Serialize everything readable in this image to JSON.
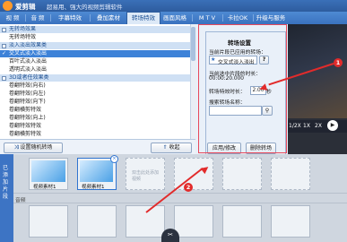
{
  "app": {
    "name": "爱剪辑",
    "slogan": "超易用、强大的视频剪辑软件"
  },
  "tabs": [
    "视 频",
    "音 频",
    "字幕特效",
    "叠加素材",
    "转场特效",
    "画面风格",
    "M T V",
    "卡拉OK",
    "升级与服务"
  ],
  "active_tab": "转场特效",
  "transition_list": [
    {
      "label": "无转场效果",
      "type": "category"
    },
    {
      "label": "无转场特效",
      "type": "item"
    },
    {
      "label": "淡入淡出效果类",
      "type": "category"
    },
    {
      "label": "交叉式淡入淡出",
      "type": "selected"
    },
    {
      "label": "百叶式淡入淡出",
      "type": "item"
    },
    {
      "label": "透明式淡入淡出",
      "type": "item"
    },
    {
      "label": "3D或者任效果类",
      "type": "category"
    },
    {
      "label": "卷翻特效(向右)",
      "type": "item"
    },
    {
      "label": "卷翻特效(向左)",
      "type": "item"
    },
    {
      "label": "卷翻特效(向下)",
      "type": "item"
    },
    {
      "label": "卷翻横剪特效",
      "type": "item"
    },
    {
      "label": "卷翻特效(向上)",
      "type": "item"
    },
    {
      "label": "卷翻特效特效",
      "type": "item"
    },
    {
      "label": "卷翻横剪特效",
      "type": "item"
    }
  ],
  "list_buttons": {
    "random": "设置随机转场",
    "collapse": "收起"
  },
  "settings": {
    "title": "转场设置",
    "current_label": "当前片段已应用的转场：",
    "current_value": "交叉式淡入淡出",
    "time_label": "当前选中片段的时长：",
    "time_value": "00:00:20.000",
    "duration_label": "转场特效时长：",
    "duration_value": "2.00",
    "duration_unit": "秒",
    "search_label": "搜索转场名称：",
    "search_placeholder": "",
    "apply": "应用/修改",
    "delete": "删除转场"
  },
  "preview_controls": {
    "speed1": "1/2X",
    "speed2": "1X",
    "speed3": "2X"
  },
  "timeline": {
    "side_tab": "已添加片段",
    "clips": [
      "视频素材1",
      "视频素材1"
    ],
    "empty_hint": "双击此处添加视频",
    "row_label": "音频"
  },
  "annotations": {
    "badge1": "1",
    "badge2": "2"
  },
  "colors": {
    "accent": "#3d82d8",
    "highlight": "#e22b2b"
  }
}
